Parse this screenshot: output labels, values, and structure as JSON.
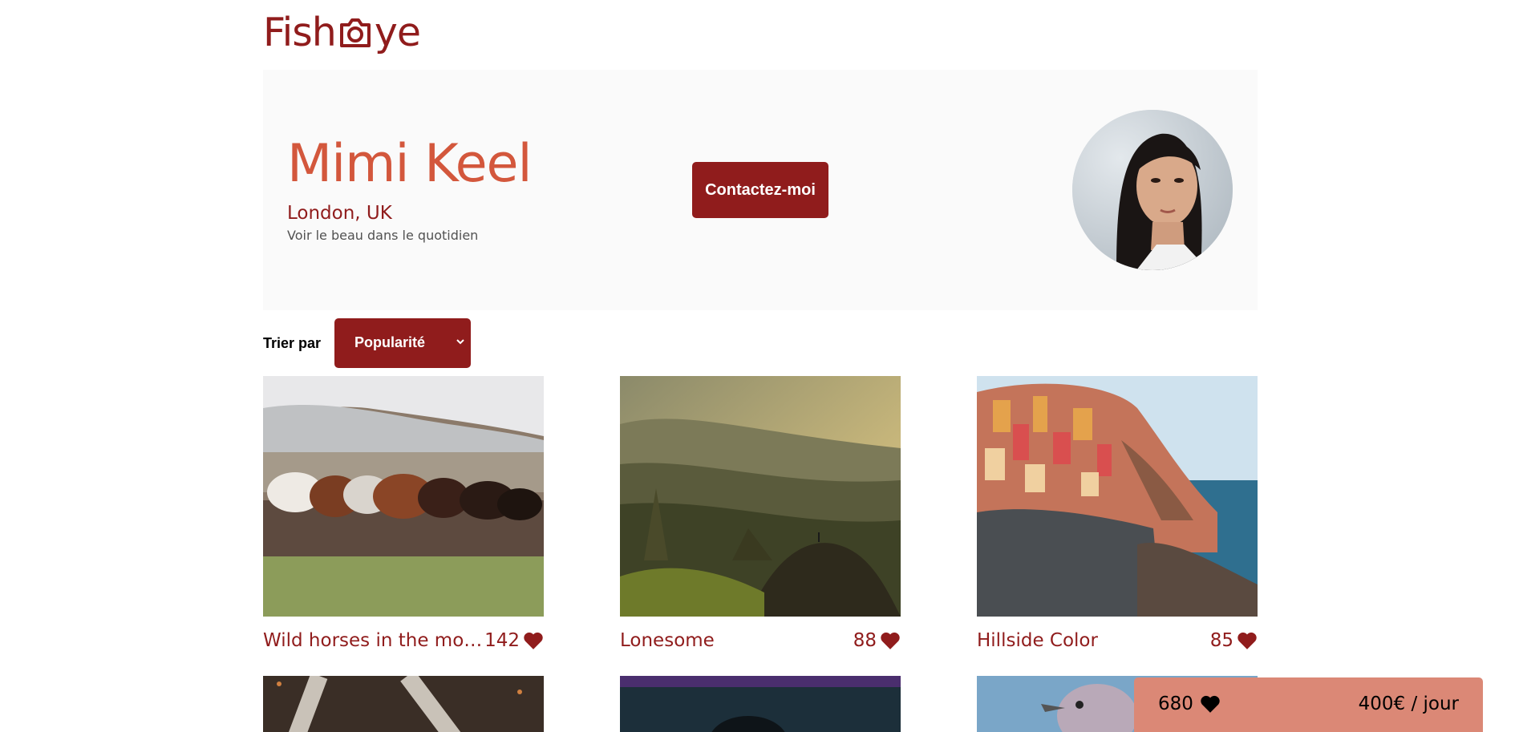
{
  "header": {
    "logo_text_left": "Fish",
    "logo_text_right": "ye",
    "logo_icon": "camera-icon"
  },
  "photographer": {
    "name": "Mimi Keel",
    "location": "London, UK",
    "tagline": "Voir le beau dans le quotidien",
    "contact_label": "Contactez-moi"
  },
  "sort": {
    "label": "Trier par",
    "selected": "Popularité",
    "icon": "chevron-down-icon"
  },
  "media": [
    {
      "title": "Wild horses in the moun…",
      "likes": "142",
      "icon": "heart-icon"
    },
    {
      "title": "Lonesome",
      "likes": "88",
      "icon": "heart-icon"
    },
    {
      "title": "Hillside Color",
      "likes": "85",
      "icon": "heart-icon"
    }
  ],
  "stats": {
    "total_likes": "680",
    "price": "400€ / jour",
    "icon": "heart-icon"
  },
  "colors": {
    "primary": "#901c1c",
    "secondary": "#d3573c",
    "stats_bg": "#db8876",
    "header_bg": "#fafafa"
  }
}
